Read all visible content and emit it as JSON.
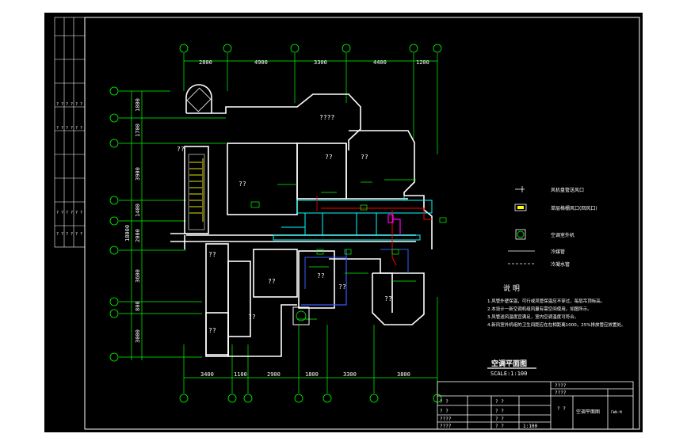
{
  "dimensions_top": [
    "2800",
    "4900",
    "3300",
    "4400",
    "1200"
  ],
  "dimensions_bottom": [
    "3400",
    "1100",
    "2900",
    "1800",
    "3300",
    "3800"
  ],
  "dimensions_left": [
    "1800",
    "1700",
    "3900",
    "1400",
    "2000",
    "3600",
    "800",
    "3000"
  ],
  "dimension_total_left": "18000",
  "room_labels": [
    "????",
    "??",
    "??",
    "??",
    "??",
    "??",
    "??",
    "??",
    "??",
    "??",
    "??",
    "??"
  ],
  "legend": [
    {
      "symbol": "line",
      "text": "风机盘管送风口"
    },
    {
      "symbol": "box",
      "text": "单层格栅风口(回风口)"
    },
    {
      "symbol": "circle",
      "text": "空调室外机"
    },
    {
      "symbol": "solid",
      "text": "冷媒管"
    },
    {
      "symbol": "dashed",
      "text": "冷凝水管"
    }
  ],
  "notes": {
    "title": "说  明",
    "lines": [
      "1.风管外壁保温，可行或凤管保温应不穿过，每层吊顶标高。",
      "2.本设计一新空调机组风量有需空间使用，如图所示。",
      "3.风管送风温度宜满足，室内空调温度可符合。",
      "4.新风室外机组的卫生间距应在在相距离1000，25%排放管应放置处。"
    ]
  },
  "drawing_title": "空调平面图",
  "drawing_scale": "SCALE:1:100",
  "title_block": {
    "cells_left": [
      "? ?",
      "? ?",
      "????",
      "????"
    ],
    "cells_mid": [
      "? ?",
      "? ?",
      "? ?",
      "? ?"
    ],
    "top_right": [
      "????",
      "????"
    ],
    "qq": "? ?",
    "name": "空调平面图",
    "number": "FWH-M",
    "scale": "1:100"
  },
  "colors": {
    "background": "#000000",
    "wall": "#ffffff",
    "axis_green": "#00ff00",
    "duct_cyan": "#00ffff",
    "pipe_red": "#ff0000",
    "pipe_blue": "#3a5bff",
    "stair_yellow": "#ffff00",
    "highlight_magenta": "#ff00ff"
  }
}
